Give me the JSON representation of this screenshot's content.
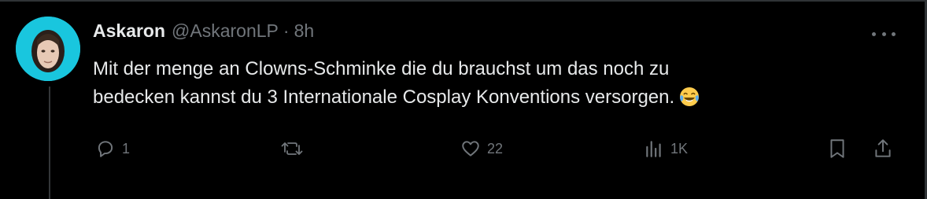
{
  "tweet": {
    "author_name": "Askaron",
    "author_handle": "@AskaronLP",
    "separator": "·",
    "time": "8h",
    "text_line1": "Mit der menge an Clowns-Schminke die du brauchst um das noch zu",
    "text_line2": "bedecken kannst du 3 Internationale Cosplay Konventions versorgen.",
    "emoji": "face-with-tears-of-joy"
  },
  "actions": {
    "reply_count": "1",
    "retweet_count": "",
    "like_count": "22",
    "views_count": "1K"
  },
  "icons": {
    "reply": "speech-bubble-icon",
    "retweet": "retweet-icon",
    "like": "heart-icon",
    "views": "bar-chart-icon",
    "bookmark": "bookmark-icon",
    "share": "share-icon",
    "more": "more-dots-icon"
  },
  "colors": {
    "background": "#000000",
    "text": "#e7e9ea",
    "muted": "#71767b",
    "avatar_bg": "#19c6de"
  }
}
